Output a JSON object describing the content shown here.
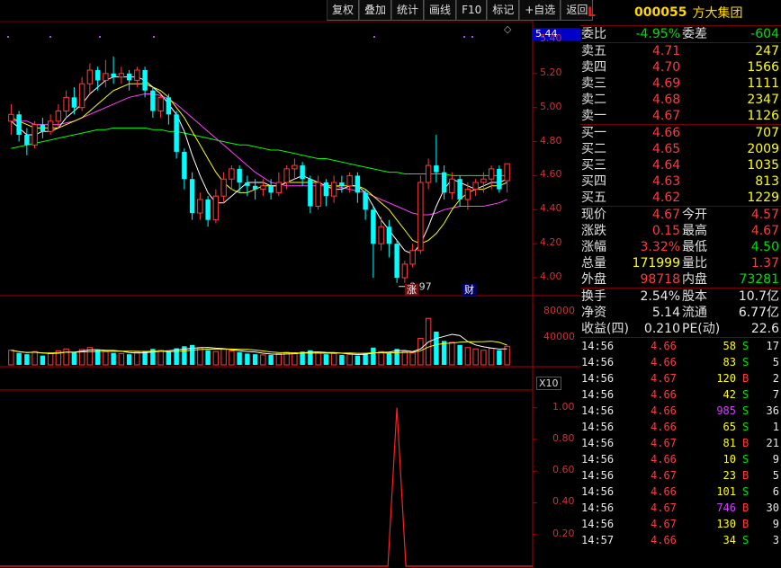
{
  "toolbar": [
    "复权",
    "叠加",
    "统计",
    "画线",
    "F10",
    "标记",
    "+自选",
    "返回"
  ],
  "stock": {
    "flag": "L",
    "code": "000055",
    "name": "方大集团"
  },
  "current_price_tag": "5.44",
  "price_axis": [
    "5.40",
    "5.20",
    "5.00",
    "4.80",
    "4.60",
    "4.40",
    "4.20",
    "4.00"
  ],
  "volume_axis": [
    "80000",
    "40000"
  ],
  "volume_unit": "X10",
  "indicator_axis": [
    "1.00",
    "0.80",
    "0.60",
    "0.40",
    "0.20"
  ],
  "annotations": {
    "low_label": "3.97",
    "tag_zhang": "涨",
    "tag_cai": "财"
  },
  "weibi": {
    "label1": "委比",
    "val1": "-4.95%",
    "label2": "委差",
    "val2": "-604"
  },
  "asks": [
    {
      "label": "卖五",
      "price": "4.71",
      "vol": "247"
    },
    {
      "label": "卖四",
      "price": "4.70",
      "vol": "1566"
    },
    {
      "label": "卖三",
      "price": "4.69",
      "vol": "1111"
    },
    {
      "label": "卖二",
      "price": "4.68",
      "vol": "2347"
    },
    {
      "label": "卖一",
      "price": "4.67",
      "vol": "1126"
    }
  ],
  "bids": [
    {
      "label": "买一",
      "price": "4.66",
      "vol": "707"
    },
    {
      "label": "买二",
      "price": "4.65",
      "vol": "2009"
    },
    {
      "label": "买三",
      "price": "4.64",
      "vol": "1035"
    },
    {
      "label": "买四",
      "price": "4.63",
      "vol": "813"
    },
    {
      "label": "买五",
      "price": "4.62",
      "vol": "1229"
    }
  ],
  "quote": [
    {
      "l1": "现价",
      "v1": "4.67",
      "c1": "red",
      "l2": "今开",
      "v2": "4.57",
      "c2": "red"
    },
    {
      "l1": "涨跌",
      "v1": "0.15",
      "c1": "red",
      "l2": "最高",
      "v2": "4.67",
      "c2": "red"
    },
    {
      "l1": "涨幅",
      "v1": "3.32%",
      "c1": "red",
      "l2": "最低",
      "v2": "4.50",
      "c2": "green"
    },
    {
      "l1": "总量",
      "v1": "171999",
      "c1": "yellow",
      "l2": "量比",
      "v2": "1.37",
      "c2": "red"
    },
    {
      "l1": "外盘",
      "v1": "98718",
      "c1": "red",
      "l2": "内盘",
      "v2": "73281",
      "c2": "green"
    }
  ],
  "stats": [
    {
      "l1": "换手",
      "v1": "2.54%",
      "l2": "股本",
      "v2": "10.7亿"
    },
    {
      "l1": "净资",
      "v1": "5.14",
      "l2": "流通",
      "v2": "6.77亿"
    },
    {
      "l1": "收益(四)",
      "v1": "0.210",
      "l2": "PE(动)",
      "v2": "22.6"
    }
  ],
  "trades": [
    {
      "time": "14:56",
      "price": "4.66",
      "pc": "red",
      "vol": "58",
      "vc": "yellow",
      "bs": "S",
      "bc": "green",
      "n": "17"
    },
    {
      "time": "14:56",
      "price": "4.66",
      "pc": "red",
      "vol": "83",
      "vc": "yellow",
      "bs": "S",
      "bc": "green",
      "n": "5"
    },
    {
      "time": "14:56",
      "price": "4.67",
      "pc": "red",
      "vol": "120",
      "vc": "yellow",
      "bs": "B",
      "bc": "red",
      "n": "2"
    },
    {
      "time": "14:56",
      "price": "4.66",
      "pc": "red",
      "vol": "42",
      "vc": "yellow",
      "bs": "S",
      "bc": "green",
      "n": "7"
    },
    {
      "time": "14:56",
      "price": "4.66",
      "pc": "red",
      "vol": "985",
      "vc": "magenta",
      "bs": "S",
      "bc": "green",
      "n": "36"
    },
    {
      "time": "14:56",
      "price": "4.66",
      "pc": "red",
      "vol": "65",
      "vc": "yellow",
      "bs": "S",
      "bc": "green",
      "n": "1"
    },
    {
      "time": "14:56",
      "price": "4.67",
      "pc": "red",
      "vol": "81",
      "vc": "yellow",
      "bs": "B",
      "bc": "red",
      "n": "21"
    },
    {
      "time": "14:56",
      "price": "4.66",
      "pc": "red",
      "vol": "10",
      "vc": "yellow",
      "bs": "S",
      "bc": "green",
      "n": "9"
    },
    {
      "time": "14:56",
      "price": "4.67",
      "pc": "red",
      "vol": "23",
      "vc": "yellow",
      "bs": "B",
      "bc": "red",
      "n": "5"
    },
    {
      "time": "14:56",
      "price": "4.66",
      "pc": "red",
      "vol": "101",
      "vc": "yellow",
      "bs": "S",
      "bc": "green",
      "n": "6"
    },
    {
      "time": "14:56",
      "price": "4.67",
      "pc": "red",
      "vol": "746",
      "vc": "magenta",
      "bs": "B",
      "bc": "red",
      "n": "30"
    },
    {
      "time": "14:56",
      "price": "4.67",
      "pc": "red",
      "vol": "130",
      "vc": "yellow",
      "bs": "B",
      "bc": "red",
      "n": "9"
    },
    {
      "time": "14:57",
      "price": "4.66",
      "pc": "red",
      "vol": "34",
      "vc": "yellow",
      "bs": "S",
      "bc": "green",
      "n": "3"
    }
  ],
  "colors": {
    "up": "#ff3b3b",
    "down": "#00ffff",
    "ma5": "#ffffff",
    "ma10": "#ffff00",
    "ma20": "#ff40ff",
    "ma60": "#00ff00"
  },
  "chart_data": {
    "type": "candlestick",
    "ylim": [
      3.9,
      5.5
    ],
    "candles": [
      [
        4.92,
        4.96,
        4.84,
        5.02
      ],
      [
        4.96,
        4.84,
        4.8,
        4.98
      ],
      [
        4.84,
        4.78,
        4.72,
        4.88
      ],
      [
        4.78,
        4.9,
        4.76,
        4.92
      ],
      [
        4.9,
        4.86,
        4.82,
        4.94
      ],
      [
        4.86,
        4.92,
        4.84,
        4.96
      ],
      [
        4.92,
        4.98,
        4.88,
        5.02
      ],
      [
        4.98,
        5.06,
        4.94,
        5.1
      ],
      [
        5.06,
        5.0,
        4.96,
        5.12
      ],
      [
        5.0,
        5.14,
        4.98,
        5.18
      ],
      [
        5.14,
        5.22,
        5.08,
        5.26
      ],
      [
        5.22,
        5.16,
        5.1,
        5.24
      ],
      [
        5.16,
        5.2,
        5.12,
        5.28
      ],
      [
        5.2,
        5.18,
        5.14,
        5.3
      ],
      [
        5.18,
        5.2,
        5.14,
        5.24
      ],
      [
        5.2,
        5.16,
        5.1,
        5.22
      ],
      [
        5.16,
        5.22,
        5.12,
        5.24
      ],
      [
        5.22,
        5.1,
        5.06,
        5.24
      ],
      [
        5.1,
        4.98,
        4.94,
        5.12
      ],
      [
        4.98,
        5.06,
        4.94,
        5.08
      ],
      [
        5.06,
        4.96,
        4.9,
        5.08
      ],
      [
        4.96,
        4.74,
        4.7,
        4.98
      ],
      [
        4.74,
        4.58,
        4.52,
        4.76
      ],
      [
        4.58,
        4.38,
        4.34,
        4.62
      ],
      [
        4.38,
        4.46,
        4.34,
        4.5
      ],
      [
        4.46,
        4.34,
        4.3,
        4.48
      ],
      [
        4.34,
        4.48,
        4.32,
        4.52
      ],
      [
        4.48,
        4.58,
        4.44,
        4.62
      ],
      [
        4.58,
        4.64,
        4.52,
        4.66
      ],
      [
        4.64,
        4.56,
        4.5,
        4.66
      ],
      [
        4.56,
        4.54,
        4.48,
        4.6
      ],
      [
        4.54,
        4.52,
        4.46,
        4.58
      ],
      [
        4.52,
        4.54,
        4.48,
        4.58
      ],
      [
        4.54,
        4.5,
        4.46,
        4.58
      ],
      [
        4.5,
        4.56,
        4.48,
        4.62
      ],
      [
        4.56,
        4.64,
        4.52,
        4.66
      ],
      [
        4.64,
        4.66,
        4.58,
        4.7
      ],
      [
        4.66,
        4.58,
        4.54,
        4.68
      ],
      [
        4.58,
        4.42,
        4.38,
        4.6
      ],
      [
        4.42,
        4.56,
        4.4,
        4.6
      ],
      [
        4.56,
        4.48,
        4.42,
        4.58
      ],
      [
        4.48,
        4.56,
        4.44,
        4.6
      ],
      [
        4.56,
        4.54,
        4.5,
        4.6
      ],
      [
        4.54,
        4.6,
        4.5,
        4.62
      ],
      [
        4.6,
        4.5,
        4.44,
        4.62
      ],
      [
        4.5,
        4.4,
        4.34,
        4.52
      ],
      [
        4.4,
        4.2,
        4.0,
        4.42
      ],
      [
        4.2,
        4.3,
        4.16,
        4.36
      ],
      [
        4.3,
        4.2,
        4.12,
        4.34
      ],
      [
        4.2,
        4.0,
        3.97,
        4.22
      ],
      [
        4.0,
        4.08,
        3.97,
        4.1
      ],
      [
        4.08,
        4.16,
        4.06,
        4.2
      ],
      [
        4.16,
        4.56,
        4.14,
        4.6
      ],
      [
        4.56,
        4.66,
        4.52,
        4.7
      ],
      [
        4.66,
        4.62,
        4.56,
        4.84
      ],
      [
        4.62,
        4.5,
        4.46,
        4.66
      ],
      [
        4.5,
        4.58,
        4.46,
        4.62
      ],
      [
        4.58,
        4.46,
        4.42,
        4.6
      ],
      [
        4.46,
        4.52,
        4.4,
        4.56
      ],
      [
        4.52,
        4.56,
        4.48,
        4.58
      ],
      [
        4.56,
        4.58,
        4.5,
        4.62
      ],
      [
        4.58,
        4.64,
        4.52,
        4.66
      ],
      [
        4.64,
        4.52,
        4.5,
        4.66
      ],
      [
        4.57,
        4.67,
        4.5,
        4.67
      ]
    ],
    "ma5": [
      4.92,
      4.88,
      4.84,
      4.84,
      4.86,
      4.86,
      4.88,
      4.94,
      4.98,
      5.02,
      5.08,
      5.12,
      5.16,
      5.18,
      5.18,
      5.18,
      5.18,
      5.16,
      5.12,
      5.08,
      5.02,
      4.96,
      4.86,
      4.72,
      4.6,
      4.5,
      4.44,
      4.44,
      4.48,
      4.52,
      4.56,
      4.56,
      4.56,
      4.54,
      4.54,
      4.56,
      4.58,
      4.6,
      4.58,
      4.56,
      4.54,
      4.52,
      4.52,
      4.54,
      4.54,
      4.5,
      4.42,
      4.34,
      4.28,
      4.22,
      4.16,
      4.14,
      4.2,
      4.3,
      4.42,
      4.52,
      4.58,
      4.56,
      4.54,
      4.52,
      4.54,
      4.56,
      4.56,
      4.58
    ],
    "ma10": [
      4.94,
      4.92,
      4.9,
      4.88,
      4.88,
      4.88,
      4.88,
      4.9,
      4.92,
      4.94,
      4.98,
      5.02,
      5.06,
      5.1,
      5.12,
      5.14,
      5.14,
      5.14,
      5.12,
      5.1,
      5.06,
      5.0,
      4.94,
      4.86,
      4.78,
      4.7,
      4.62,
      4.56,
      4.52,
      4.5,
      4.5,
      4.52,
      4.54,
      4.54,
      4.54,
      4.56,
      4.56,
      4.56,
      4.56,
      4.56,
      4.54,
      4.54,
      4.54,
      4.54,
      4.54,
      4.52,
      4.48,
      4.44,
      4.4,
      4.34,
      4.28,
      4.22,
      4.2,
      4.22,
      4.26,
      4.32,
      4.4,
      4.46,
      4.5,
      4.52,
      4.52,
      4.54,
      4.54,
      4.56
    ],
    "ma20": [
      4.92,
      4.92,
      4.92,
      4.9,
      4.9,
      4.9,
      4.9,
      4.91,
      4.92,
      4.94,
      4.96,
      4.98,
      5.0,
      5.02,
      5.04,
      5.06,
      5.07,
      5.08,
      5.08,
      5.07,
      5.05,
      5.02,
      4.98,
      4.94,
      4.9,
      4.86,
      4.82,
      4.78,
      4.74,
      4.7,
      4.66,
      4.62,
      4.59,
      4.56,
      4.55,
      4.54,
      4.54,
      4.54,
      4.54,
      4.54,
      4.54,
      4.54,
      4.53,
      4.52,
      4.51,
      4.5,
      4.48,
      4.46,
      4.44,
      4.42,
      4.4,
      4.38,
      4.37,
      4.37,
      4.38,
      4.4,
      4.41,
      4.42,
      4.42,
      4.42,
      4.42,
      4.43,
      4.44,
      4.46
    ],
    "ma60": [
      4.76,
      4.77,
      4.78,
      4.79,
      4.8,
      4.81,
      4.82,
      4.83,
      4.84,
      4.85,
      4.86,
      4.87,
      4.87,
      4.88,
      4.88,
      4.88,
      4.88,
      4.88,
      4.87,
      4.87,
      4.86,
      4.86,
      4.85,
      4.84,
      4.83,
      4.82,
      4.81,
      4.8,
      4.79,
      4.78,
      4.78,
      4.77,
      4.76,
      4.75,
      4.75,
      4.74,
      4.73,
      4.72,
      4.71,
      4.7,
      4.7,
      4.69,
      4.68,
      4.67,
      4.66,
      4.65,
      4.64,
      4.63,
      4.62,
      4.62,
      4.61,
      4.61,
      4.61,
      4.61,
      4.61,
      4.61,
      4.6,
      4.6,
      4.6,
      4.6,
      4.6,
      4.6,
      4.6,
      4.6
    ],
    "volume": [
      22000,
      18000,
      16000,
      20000,
      14000,
      17000,
      21000,
      24000,
      19000,
      23000,
      26000,
      22000,
      20000,
      18000,
      17000,
      16000,
      19000,
      21000,
      24000,
      22000,
      20000,
      25000,
      28000,
      30000,
      26000,
      22000,
      20000,
      24000,
      21000,
      19000,
      17000,
      16000,
      15000,
      15000,
      17000,
      19000,
      18000,
      20000,
      22000,
      18000,
      16000,
      17000,
      15000,
      16000,
      14000,
      18000,
      26000,
      20000,
      18000,
      24000,
      20000,
      18000,
      40000,
      70000,
      50000,
      36000,
      34000,
      30000,
      26000,
      24000,
      22000,
      25000,
      22000,
      28000
    ],
    "volume_ylim": [
      0,
      100000
    ],
    "indicator": {
      "ylim": [
        0,
        1.1
      ],
      "spike_index": 49,
      "spike_value": 1.0
    }
  }
}
